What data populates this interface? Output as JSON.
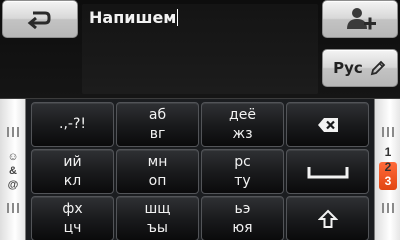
{
  "input": {
    "text": "Напишем"
  },
  "top_buttons": {
    "language_label": "Рус"
  },
  "keyboard": {
    "rows": [
      [
        {
          "line1": ".,-?!",
          "line2": ""
        },
        {
          "line1": "аб",
          "line2": "вг"
        },
        {
          "line1": "деё",
          "line2": "жз"
        }
      ],
      [
        {
          "line1": "ий",
          "line2": "кл"
        },
        {
          "line1": "мн",
          "line2": "оп"
        },
        {
          "line1": "рс",
          "line2": "ту"
        }
      ],
      [
        {
          "line1": "фх",
          "line2": "цч"
        },
        {
          "line1": "шщ",
          "line2": "ъы"
        },
        {
          "line1": "ьэ",
          "line2": "юя"
        }
      ]
    ],
    "action_keys": [
      "backspace-icon",
      "space-icon",
      "shift-icon"
    ],
    "left_tab": {
      "symbols": [
        "☺",
        "&",
        "@"
      ]
    },
    "right_tab": {
      "numbers": [
        "1",
        "2",
        "3"
      ],
      "active": "3"
    }
  },
  "colors": {
    "accent": "#e8531c",
    "background": "#000000",
    "key_face": "#1a1b1d",
    "light_button": "#d8d8d8"
  }
}
